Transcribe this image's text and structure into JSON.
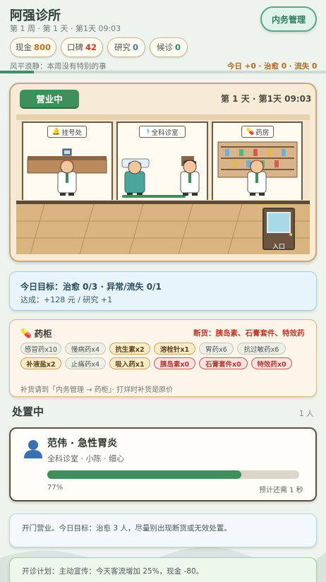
{
  "header": {
    "title": "阿强诊所",
    "subtitle": "第 1 周 · 第 1 天 · 第1天 09:03",
    "manage_button": "内务管理",
    "news": "风平浪静：本周没有特别的事",
    "today_summary": "今日 +0 · 治愈 0 · 流失 0"
  },
  "stats": [
    {
      "label": "现金",
      "value": "800",
      "color": "#b8731c"
    },
    {
      "label": "口碑",
      "value": "42",
      "color": "#c0392b"
    },
    {
      "label": "研究",
      "value": "0",
      "color": "#3a7ab8"
    },
    {
      "label": "候诊",
      "value": "0",
      "color": "#2f8f6d"
    }
  ],
  "clinic": {
    "status_badge": "营业中",
    "time_label": "第 1 天 · 第1天 09:03",
    "rooms": [
      {
        "name": "挂号处",
        "icon": "bell-icon"
      },
      {
        "name": "全科诊室",
        "icon": "stethoscope-icon"
      },
      {
        "name": "药房",
        "icon": "pill-icon"
      }
    ],
    "exit_label": "入口",
    "treatment_progress": 0.77
  },
  "goal": {
    "main": "今日目标：治愈 0/3 · 异常/流失 0/1",
    "sub": "达成：+128 元 / 研究 +1"
  },
  "medicine": {
    "title": "药柜",
    "shortage": "断货：胰岛素、石膏套件、特效药",
    "items": [
      {
        "label": "感冒药x10",
        "state": "normal"
      },
      {
        "label": "慢病药x4",
        "state": "normal"
      },
      {
        "label": "抗生素x2",
        "state": "low"
      },
      {
        "label": "溶栓针x1",
        "state": "low"
      },
      {
        "label": "胃药x6",
        "state": "normal"
      },
      {
        "label": "抗过敏药x6",
        "state": "normal"
      },
      {
        "label": "补液盐x2",
        "state": "low"
      },
      {
        "label": "止痛药x4",
        "state": "normal"
      },
      {
        "label": "吸入药x1",
        "state": "low"
      },
      {
        "label": "胰岛素x0",
        "state": "out"
      },
      {
        "label": "石膏套件x0",
        "state": "out"
      },
      {
        "label": "特效药x0",
        "state": "out"
      }
    ],
    "note": "补货请到「内务管理 → 药柜」· 打烊时补货是原价"
  },
  "treating": {
    "title": "处置中",
    "count": "1 人",
    "patient_name": "范伟 · 急性胃炎",
    "patient_info": "全科诊室 · 小陈 · 细心",
    "progress": 0.77,
    "progress_label": "77%",
    "eta": "预计还需 1 秒"
  },
  "logs": [
    "开门营业。今日目标：治愈 3 人，尽量别出现断货或无效处置。",
    "开诊计划：主动宣传：今天客流增加 25%，现金 -80。"
  ]
}
